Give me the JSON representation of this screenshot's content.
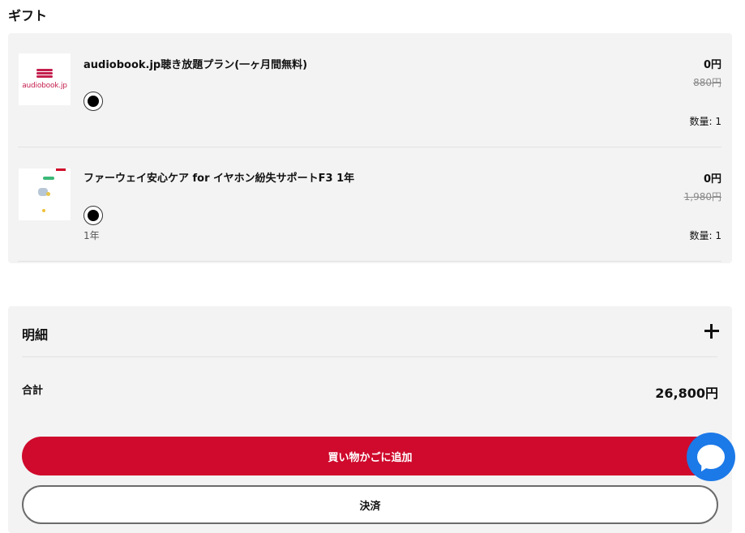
{
  "gift": {
    "title": "ギフト",
    "items": [
      {
        "name": "audiobook.jp聴き放題プラン(一ヶ月間無料)",
        "price": "0円",
        "original_price": "880円",
        "quantity": "数量: 1",
        "variant": "",
        "thumbnail_label": "audiobook.jp"
      },
      {
        "name": "ファーウェイ安心ケア for イヤホン紛失サポートF3 1年",
        "price": "0円",
        "original_price": "1,980円",
        "quantity": "数量: 1",
        "variant": "1年"
      }
    ]
  },
  "summary": {
    "detail_label": "明細",
    "total_label": "合計",
    "total_value": "26,800円",
    "add_to_cart_label": "買い物かごに追加",
    "checkout_label": "決済"
  },
  "colors": {
    "primary": "#cf0a2c",
    "chat": "#1c79e8",
    "panel": "#f3f3f3"
  },
  "icons": {
    "expand": "plus-icon",
    "chat": "chat-icon"
  }
}
